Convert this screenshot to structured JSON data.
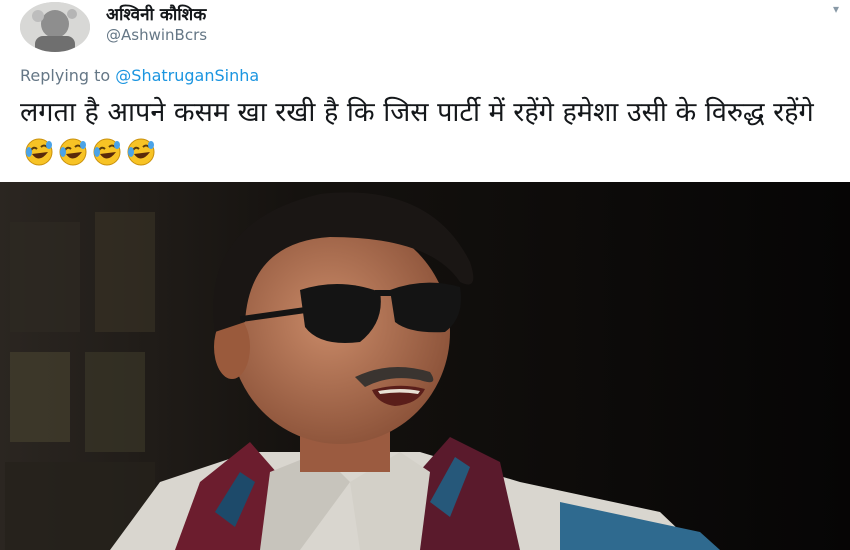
{
  "tweet": {
    "author_name": "अश्विनी कौशिक",
    "author_handle": "@AshwinBcrs",
    "replying_to_label": "Replying to",
    "replying_to_handle": "@ShatruganSinha",
    "text": "लगता है आपने कसम खा रखी है कि जिस पार्टी में रहेंगे हमेशा उसी के विरुद्ध रहेंगे",
    "emojis": [
      "rolling-on-floor-laughing",
      "rolling-on-floor-laughing",
      "rolling-on-floor-laughing",
      "rolling-on-floor-laughing"
    ]
  },
  "icons": {
    "menu": "chevron-down-icon"
  },
  "colors": {
    "link": "#1b95e0",
    "muted": "#657786",
    "text": "#14171a"
  }
}
